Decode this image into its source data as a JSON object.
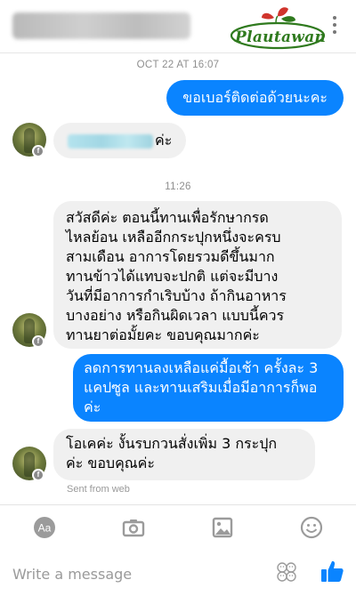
{
  "header": {
    "logo_text": "Plautawan",
    "contact_name": "Thai contact name (blurred)"
  },
  "messages": {
    "timestamp_1": "OCT 22 AT 16:07",
    "out_1": "ขอเบอร์ติดต่อด้วยนะคะ",
    "in_1_suffix": "ค่ะ",
    "timestamp_2": "11:26",
    "in_2_lines": [
      "สวัสดีค่ะ ตอนนี้ทานเพื่อรักษากรด",
      "ไหลย้อน เหลืออีกกระปุกหนึ่งจะครบ",
      "สามเดือน อาการโดยรวมดีขึ้นมาก",
      "ทานข้าวได้แทบจะปกติ แต่จะมีบาง",
      "วันที่มีอาการกำเริบบ้าง ถ้ากินอาหาร",
      "บางอย่าง หรือกินผิดเวลา แบบนี้ควร",
      "ทานยาต่อมั้ยคะ ขอบคุณมากค่ะ"
    ],
    "out_2_lines": [
      "ลดการทานลงเหลือแค่มื้อเช้า ครั้งละ 3",
      "แคปซูล และทานเสริมเมื่อมีอาการก็พอ",
      "ค่ะ"
    ],
    "in_3_lines": [
      "โอเคค่ะ งั้นรบกวนสั่งเพิ่ม 3 กระปุก",
      "ค่ะ ขอบคุณค่ะ"
    ],
    "sent_from": "Sent from web"
  },
  "toolbar": {
    "icons": [
      "text-format-icon",
      "camera-icon",
      "image-icon",
      "emoji-icon"
    ],
    "icon_color": "#9b9b9b"
  },
  "composer": {
    "placeholder": "Write a message",
    "like_color": "#0a84ff"
  },
  "colors": {
    "outgoing_bubble": "#0a84ff",
    "incoming_bubble": "#f0f0f0",
    "logo_green": "#2f7a1e",
    "logo_red": "#d0342c"
  }
}
